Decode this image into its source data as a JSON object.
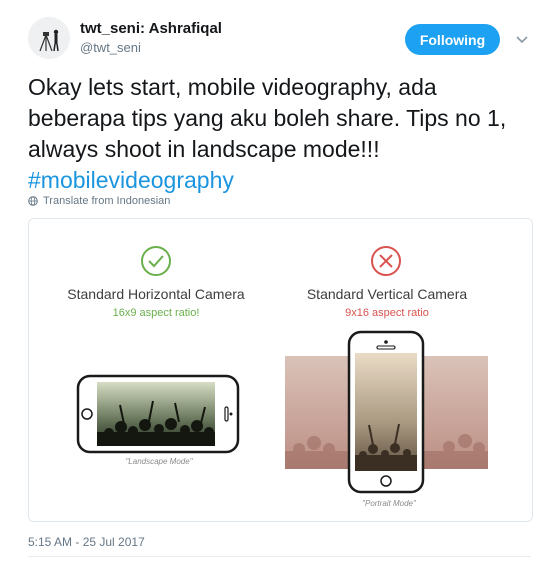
{
  "user": {
    "display_name": "twt_seni: Ashrafiqal",
    "handle": "@twt_seni"
  },
  "follow_button": {
    "label": "Following"
  },
  "tweet": {
    "text": "Okay lets start, mobile videography, ada beberapa tips yang aku boleh share. Tips no 1, always shoot in landscape mode!!! ",
    "hashtag": "#mobilevideography"
  },
  "translate": {
    "label": "Translate from Indonesian"
  },
  "card": {
    "left": {
      "title": "Standard Horizontal Camera",
      "subtitle": "16x9 aspect ratio!",
      "caption": "\"Landscape Mode\"",
      "status_color": "#6ab04c"
    },
    "right": {
      "title": "Standard Vertical Camera",
      "subtitle": "9x16 aspect ratio",
      "caption": "\"Portrait Mode\"",
      "status_color": "#d9534f"
    }
  },
  "timestamp": "5:15 AM - 25 Jul 2017",
  "colors": {
    "accent": "#1da1f2",
    "hashtag": "#1b95e0"
  }
}
